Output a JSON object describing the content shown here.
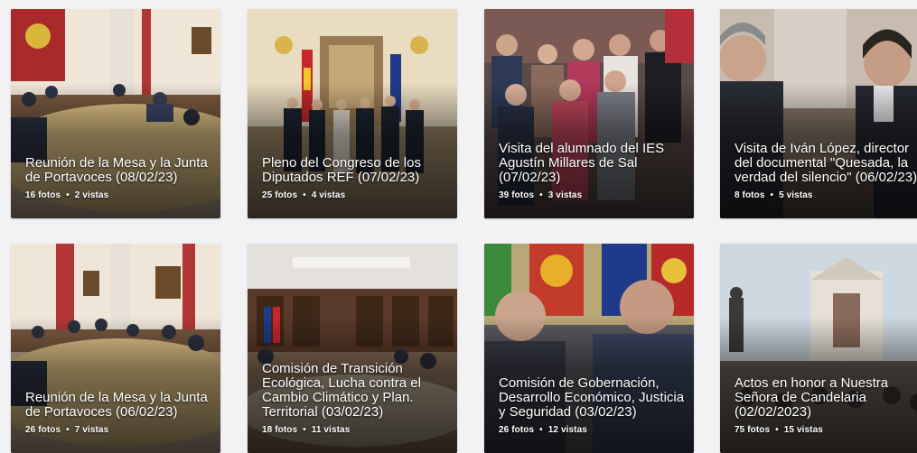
{
  "albums": [
    {
      "title": "Reunión de la Mesa y la Junta de Portavoces (08/02/23)",
      "photos": "16 fotos",
      "views": "2 vistas"
    },
    {
      "title": "Pleno del Congreso de los Diputados REF (07/02/23)",
      "photos": "25 fotos",
      "views": "4 vistas"
    },
    {
      "title": "Visita del alumnado del IES Agustín Millares de Sal (07/02/23)",
      "photos": "39 fotos",
      "views": "3 vistas"
    },
    {
      "title": "Visita de Iván López, director del documental \"Quesada, la verdad del silencio\" (06/02/23)",
      "photos": "8 fotos",
      "views": "5 vistas"
    },
    {
      "title": "Reunión de la Mesa y la Junta de Portavoces (06/02/23)",
      "photos": "26 fotos",
      "views": "7 vistas"
    },
    {
      "title": "Comisión de Transición Ecológica, Lucha contra el Cambio Climático y Plan. Territorial (03/02/23)",
      "photos": "18 fotos",
      "views": "11 vistas"
    },
    {
      "title": "Comisión de Gobernación, Desarrollo Económico, Justicia y Seguridad (03/02/23)",
      "photos": "26 fotos",
      "views": "12 vistas"
    },
    {
      "title": "Actos en honor a Nuestra Señora de Candelaria (02/02/2023)",
      "photos": "75 fotos",
      "views": "15 vistas"
    }
  ],
  "separator": "•"
}
